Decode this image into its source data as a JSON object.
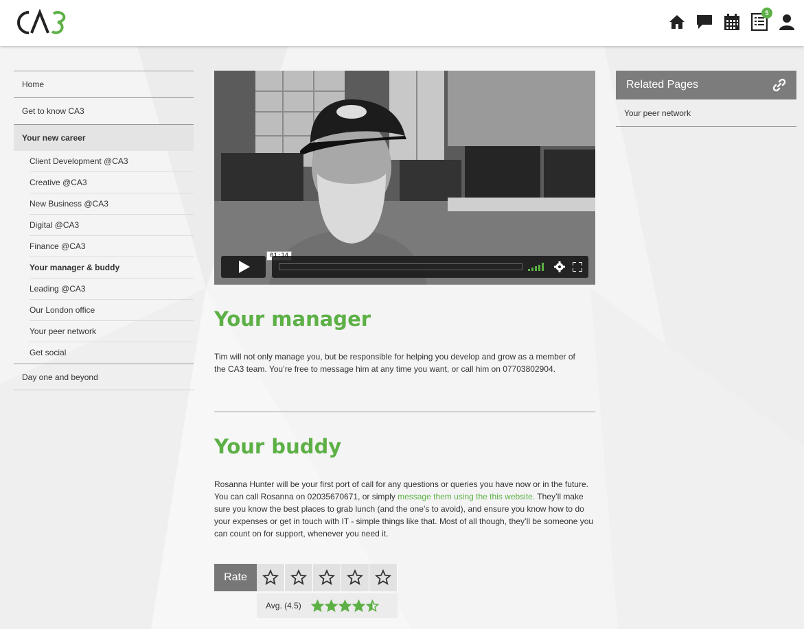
{
  "brand": {
    "logo_text": "CA3",
    "accent_color": "#5db046"
  },
  "header": {
    "icons": [
      "home-icon",
      "chat-icon",
      "calendar-icon",
      "tasks-icon",
      "user-icon"
    ],
    "tasks_badge": "5"
  },
  "sidebar": {
    "items": [
      {
        "label": "Home"
      },
      {
        "label": "Get to know CA3"
      },
      {
        "label": "Your new career",
        "active": true
      },
      {
        "label": "Day one and beyond"
      }
    ],
    "subitems": [
      {
        "label": "Client Development @CA3"
      },
      {
        "label": "Creative @CA3"
      },
      {
        "label": "New Business @CA3"
      },
      {
        "label": "Digital @CA3"
      },
      {
        "label": "Finance @CA3"
      },
      {
        "label": "Your manager & buddy",
        "current": true
      },
      {
        "label": "Leading @CA3"
      },
      {
        "label": "Our London office"
      },
      {
        "label": "Your peer network"
      },
      {
        "label": "Get social"
      }
    ]
  },
  "video": {
    "time_tooltip": "01:14",
    "progress": 0
  },
  "content": {
    "manager_title": "Your manager",
    "manager_text": "Tim will not only manage you, but be responsible for helping you develop and grow as a member of the CA3 team. You’re free to message him at any time you want, or call him on 07703802904.",
    "buddy_title": "Your buddy",
    "buddy_text_1": "Rosanna Hunter will be your first port of call for any questions or queries you have now or in the future. You can call Rosanna on 02035670671, or simply ",
    "buddy_link": "message them using the this website.",
    "buddy_text_2": " They’ll make sure you know the best places to grab lunch (and the one’s to avoid), and ensure you know how to do your expenses or get in touch with IT - simple things like that. Most of all though, they’ll be someone you can count on for support, whenever you need it."
  },
  "rating": {
    "label": "Rate",
    "avg_label": "Avg. (4.5)",
    "avg_value": 4.5,
    "max": 5
  },
  "related": {
    "title": "Related Pages",
    "items": [
      {
        "label": "Your peer network"
      }
    ]
  }
}
